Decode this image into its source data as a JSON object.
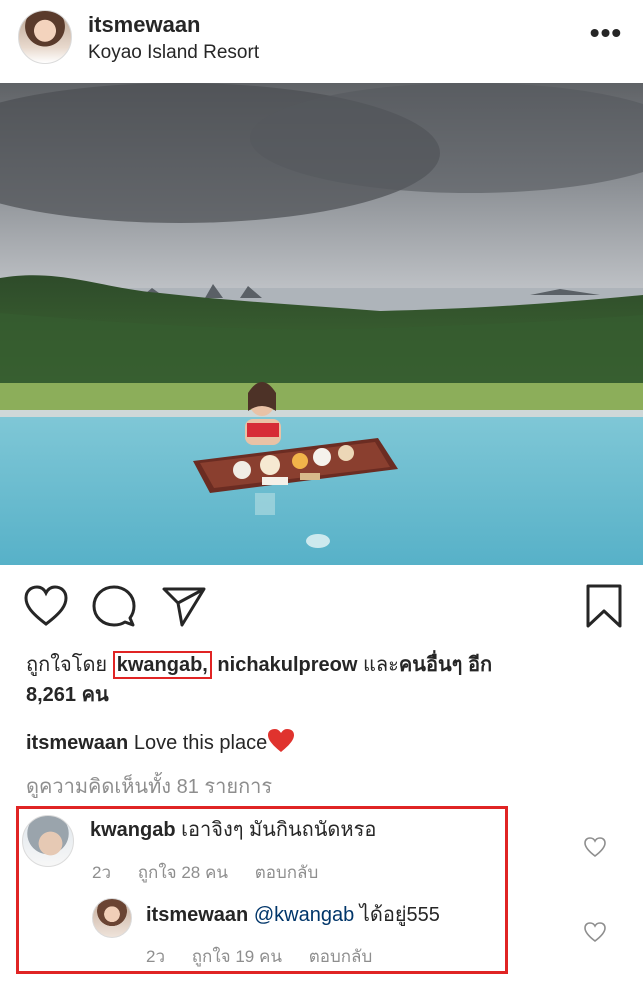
{
  "post": {
    "username": "itsmewaan",
    "location": "Koyao Island Resort",
    "more_icon": "more-horizontal-icon"
  },
  "actions": {
    "icons": [
      "heart-icon",
      "comment-icon",
      "share-icon",
      "bookmark-icon"
    ]
  },
  "likes": {
    "prefix": "ถูกใจโดย",
    "user1": "kwangab",
    "separator": ",",
    "user2": "nichakulpreow",
    "and_text": "และ",
    "others_text": "คนอื่นๆ อีก",
    "count_text": "8,261 คน"
  },
  "caption": {
    "username": "itsmewaan",
    "text": "Love this place"
  },
  "view_all_comments": "ดูความคิดเห็นทั้ง 81 รายการ",
  "comments": [
    {
      "username": "kwangab",
      "text": "เอาจิงๆ มันกินถนัดหรอ",
      "time": "2ว",
      "likes": "ถูกใจ 28 คน",
      "reply": "ตอบกลับ"
    },
    {
      "username": "itsmewaan",
      "mention": "@kwangab",
      "text": "ได้อยู่555",
      "time": "2ว",
      "likes": "ถูกใจ 19 คน",
      "reply": "ตอบกลับ"
    }
  ],
  "colors": {
    "highlight": "#e02424",
    "text": "#262626",
    "muted": "#8e8e8e",
    "mention": "#003569",
    "heart_emoji": "#e0332e"
  }
}
